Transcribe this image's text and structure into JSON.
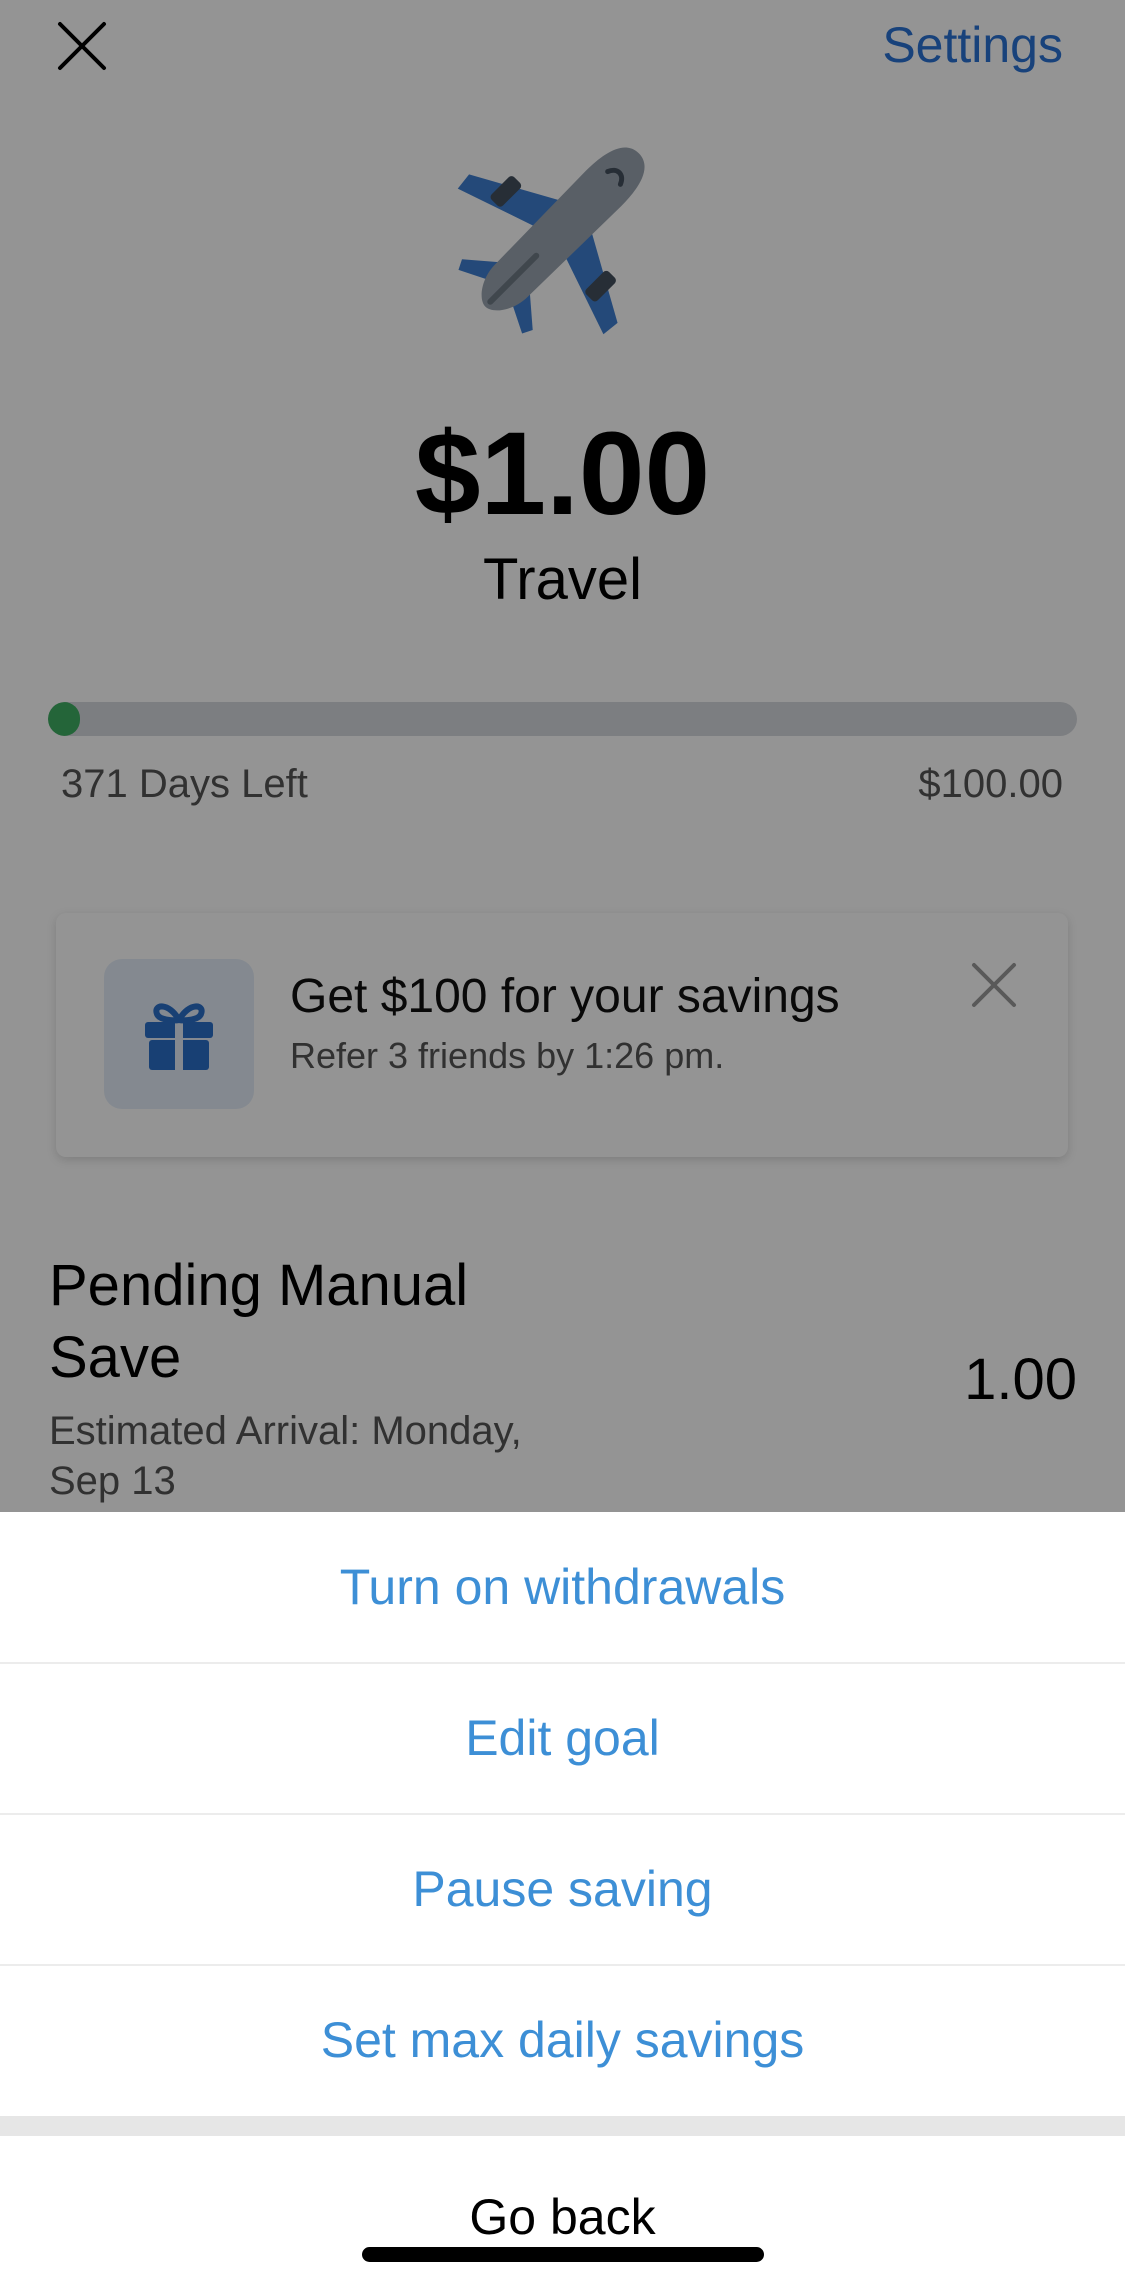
{
  "header": {
    "close_icon": "close-icon",
    "settings_label": "Settings"
  },
  "goal": {
    "icon": "airplane-icon",
    "balance": "$1.00",
    "name": "Travel",
    "progress_fraction": 0.01,
    "days_left": "371 Days Left",
    "target_amount": "$100.00"
  },
  "promo": {
    "icon": "gift-icon",
    "title": "Get $100 for your savings",
    "subtitle": "Refer 3 friends by 1:26 pm.",
    "dismiss_icon": "close-icon"
  },
  "pending": {
    "title": "Pending Manual Save",
    "subtitle": "Estimated Arrival: Monday, Sep 13",
    "amount": "1.00"
  },
  "action_sheet": {
    "actions": [
      "Turn on withdrawals",
      "Edit goal",
      "Pause saving",
      "Set max daily savings"
    ],
    "cancel_label": "Go back"
  },
  "colors": {
    "accent": "#2a73d4",
    "action_text": "#3d8fd6",
    "progress": "#3fae63",
    "plane_body": "#9aa4b0",
    "plane_wing": "#3f7fd0"
  }
}
